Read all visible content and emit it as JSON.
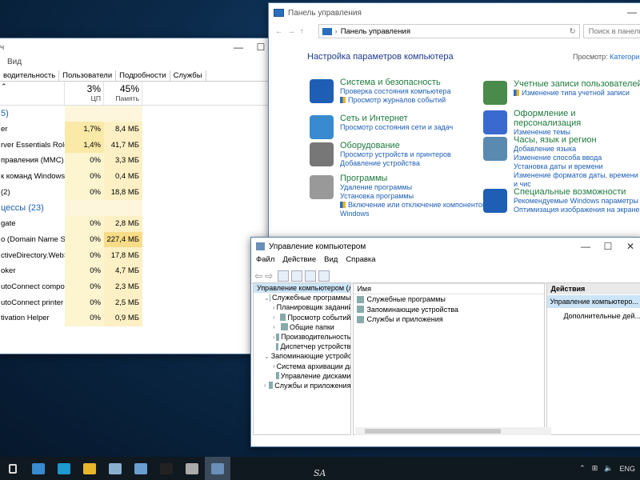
{
  "task_manager": {
    "title_partial": "ч",
    "menu_view": "Вид",
    "tabs": [
      "водительность",
      "Пользователи",
      "Подробности",
      "Службы"
    ],
    "cpu_pct": "3%",
    "cpu_label": "ЦП",
    "mem_pct": "45%",
    "mem_label": "Память",
    "rows": [
      {
        "name": "5)",
        "cpu": "",
        "mem": "",
        "group": true
      },
      {
        "name": "er",
        "cpu": "1,7%",
        "mem": "8,4 МБ"
      },
      {
        "name": "rver Essentials Role ...",
        "cpu": "1,4%",
        "mem": "41,7 МБ"
      },
      {
        "name": "правления (MMC)",
        "cpu": "0%",
        "mem": "3,3 МБ"
      },
      {
        "name": "к команд Windows",
        "cpu": "0%",
        "mem": "0,4 МБ"
      },
      {
        "name": "(2)",
        "cpu": "0%",
        "mem": "18,8 МБ"
      },
      {
        "name": "цессы (23)",
        "cpu": "",
        "mem": "",
        "group": true
      },
      {
        "name": "gate",
        "cpu": "0%",
        "mem": "2,8 МБ"
      },
      {
        "name": "o (Domain Name Sy...",
        "cpu": "0%",
        "mem": "227,4 МБ"
      },
      {
        "name": "ctiveDirectory.WebS...",
        "cpu": "0%",
        "mem": "17,8 МБ"
      },
      {
        "name": "oker",
        "cpu": "0%",
        "mem": "4,7 МБ"
      },
      {
        "name": "utoConnect compo...",
        "cpu": "0%",
        "mem": "2,3 МБ"
      },
      {
        "name": "utoConnect printer ...",
        "cpu": "0%",
        "mem": "2,5 МБ"
      },
      {
        "name": "tivation Helper",
        "cpu": "0%",
        "mem": "0,9 МБ"
      }
    ]
  },
  "control_panel": {
    "title": "Панель управления",
    "address": "Панель управления",
    "search_placeholder": "Поиск в панели упр",
    "heading": "Настройка параметров компьютера",
    "view_by_label": "Просмотр:",
    "view_by_value": "Категория",
    "categories_left": [
      {
        "title": "Система и безопасность",
        "links": [
          "Проверка состояния компьютера",
          "Просмотр журналов событий"
        ],
        "shields": [
          false,
          true
        ],
        "color": "#1e5fb5"
      },
      {
        "title": "Сеть и Интернет",
        "links": [
          "Просмотр состояния сети и задач"
        ],
        "shields": [
          false
        ],
        "color": "#3a8ad0"
      },
      {
        "title": "Оборудование",
        "links": [
          "Просмотр устройств и принтеров",
          "Добавление устройства"
        ],
        "shields": [
          false,
          false
        ],
        "color": "#777777"
      },
      {
        "title": "Программы",
        "links": [
          "Удаление программы",
          "Установка программы",
          "Включение или отключение компонентов",
          "Windows"
        ],
        "shields": [
          false,
          false,
          true,
          false
        ],
        "color": "#999999"
      }
    ],
    "categories_right": [
      {
        "title": "Учетные записи пользователей",
        "links": [
          "Изменение типа учетной записи"
        ],
        "shields": [
          true
        ],
        "color": "#4a8a4a"
      },
      {
        "title": "Оформление и персонализация",
        "links": [
          "Изменение темы"
        ],
        "shields": [
          false
        ],
        "color": "#3a6ad0"
      },
      {
        "title": "Часы, язык и регион",
        "links": [
          "Добавление языка",
          "Изменение способа ввода",
          "Установка даты и времени",
          "Изменение форматов даты, времени и чис"
        ],
        "shields": [
          false,
          false,
          false,
          false
        ],
        "color": "#5a8ab0"
      },
      {
        "title": "Специальные возможности",
        "links": [
          "Рекомендуемые Windows параметры",
          "Оптимизация изображения на экране"
        ],
        "shields": [
          false,
          false
        ],
        "color": "#1e5fb5"
      }
    ]
  },
  "computer_management": {
    "title": "Управление компьютером",
    "menu": [
      "Файл",
      "Действие",
      "Вид",
      "Справка"
    ],
    "tree": [
      {
        "label": "Управление компьютером (л",
        "level": 0,
        "arrow": "",
        "selected": true
      },
      {
        "label": "Служебные программы",
        "level": 1,
        "arrow": "⌄"
      },
      {
        "label": "Планировщик заданий",
        "level": 2,
        "arrow": "›"
      },
      {
        "label": "Просмотр событий",
        "level": 2,
        "arrow": "›"
      },
      {
        "label": "Общие папки",
        "level": 2,
        "arrow": "›"
      },
      {
        "label": "Производительность",
        "level": 2,
        "arrow": "›"
      },
      {
        "label": "Диспетчер устройств",
        "level": 2,
        "arrow": ""
      },
      {
        "label": "Запоминающие устройст",
        "level": 1,
        "arrow": "⌄"
      },
      {
        "label": "Система архивации да",
        "level": 2,
        "arrow": "›"
      },
      {
        "label": "Управление дисками",
        "level": 2,
        "arrow": ""
      },
      {
        "label": "Службы и приложения",
        "level": 1,
        "arrow": "›"
      }
    ],
    "list_header": "Имя",
    "list_items": [
      "Служебные программы",
      "Запоминающие устройства",
      "Службы и приложения"
    ],
    "actions_header": "Действия",
    "actions_selected": "Управление компьютеро...",
    "actions_more": "Дополнительные дей..."
  },
  "taskbar": {
    "sa_label": "SA",
    "lang": "ENG",
    "icons": [
      "start-icon",
      "server-manager-icon",
      "ie-icon",
      "explorer-icon",
      "admin-tools-icon",
      "computer-management-icon",
      "cmd-icon",
      "device-icon",
      "task-manager-icon"
    ]
  }
}
